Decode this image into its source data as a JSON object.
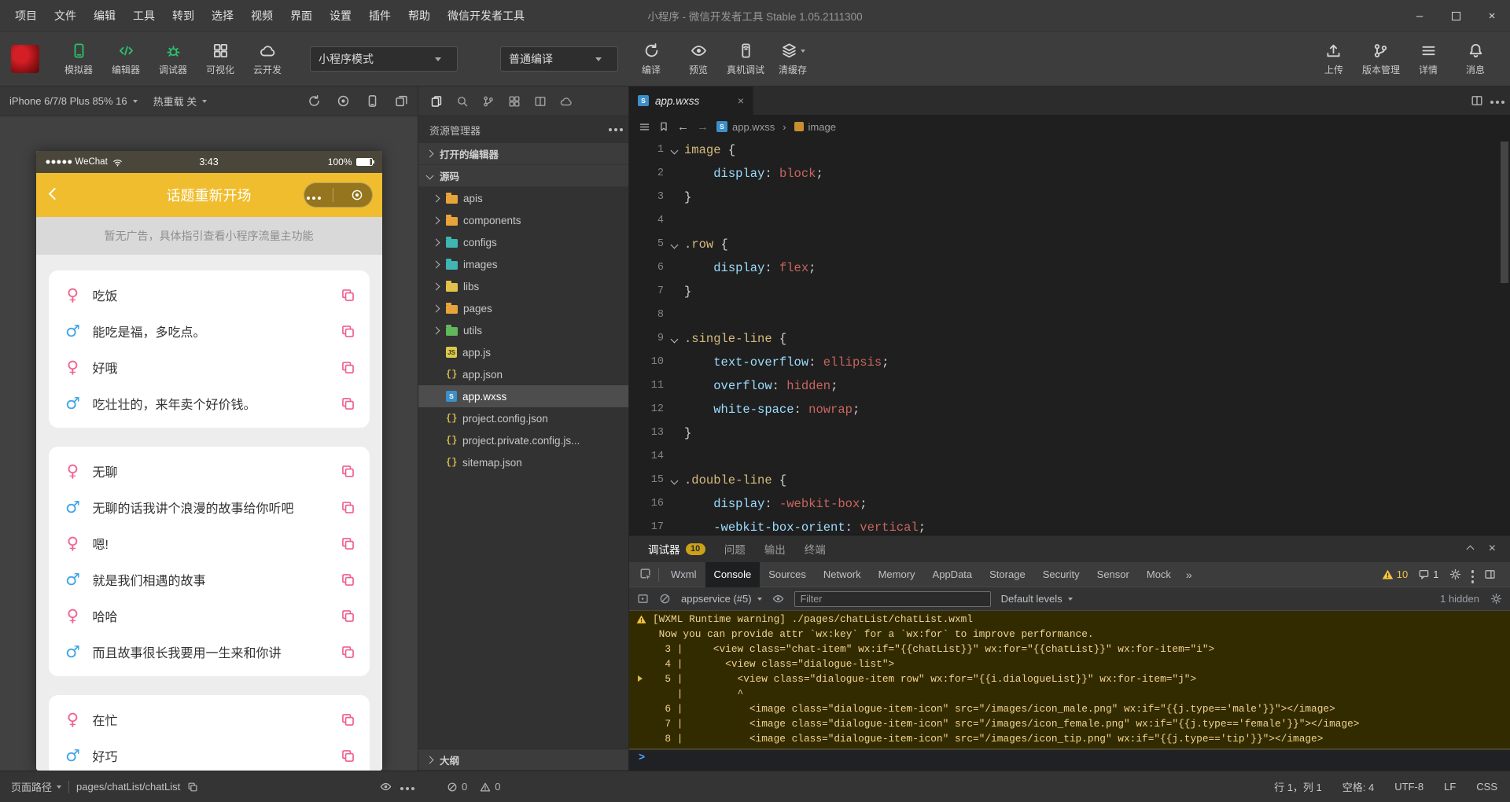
{
  "titlebar": {
    "menus": [
      "项目",
      "文件",
      "编辑",
      "工具",
      "转到",
      "选择",
      "视频",
      "界面",
      "设置",
      "插件",
      "帮助",
      "微信开发者工具"
    ],
    "title": "小程序 - 微信开发者工具 Stable 1.05.2111300"
  },
  "toolbar": {
    "main_tools": [
      {
        "label": "模拟器",
        "icon": "simulator-icon",
        "accent": true
      },
      {
        "label": "编辑器",
        "icon": "editor-icon",
        "accent": true
      },
      {
        "label": "调试器",
        "icon": "debugger-icon",
        "accent": true
      },
      {
        "label": "可视化",
        "icon": "visualizer-icon",
        "accent": false
      },
      {
        "label": "云开发",
        "icon": "cloud-dev-icon",
        "accent": false
      }
    ],
    "mode_select": "小程序模式",
    "compile_select": "普通编译",
    "compile_actions": [
      {
        "label": "编译",
        "icon": "compile-icon"
      },
      {
        "label": "预览",
        "icon": "preview-icon"
      },
      {
        "label": "真机调试",
        "icon": "remote-debug-icon"
      },
      {
        "label": "清缓存",
        "icon": "clear-cache-icon",
        "caret": true
      }
    ],
    "right_tools": [
      {
        "label": "上传",
        "icon": "upload-icon"
      },
      {
        "label": "版本管理",
        "icon": "version-icon"
      },
      {
        "label": "详情",
        "icon": "details-icon"
      },
      {
        "label": "消息",
        "icon": "message-icon"
      }
    ]
  },
  "simulator": {
    "device_label": "iPhone 6/7/8 Plus 85% 16",
    "hot_reload_label": "热重载 关",
    "toolbar_icons": [
      "refresh-icon",
      "record-icon",
      "device-icon",
      "multi-device-icon"
    ],
    "phone": {
      "carrier": "●●●●● WeChat",
      "time": "3:43",
      "battery": "100%",
      "nav_title": "话题重新开场",
      "ad_banner": "暂无广告，具体指引查看小程序流量主功能",
      "chat_cards": [
        {
          "rows": [
            {
              "gender": "female",
              "text": "吃饭"
            },
            {
              "gender": "male",
              "text": "能吃是福，多吃点。"
            },
            {
              "gender": "female",
              "text": "好哦"
            },
            {
              "gender": "male",
              "text": "吃壮壮的，来年卖个好价钱。"
            }
          ]
        },
        {
          "rows": [
            {
              "gender": "female",
              "text": "无聊"
            },
            {
              "gender": "male",
              "text": "无聊的话我讲个浪漫的故事给你听吧"
            },
            {
              "gender": "female",
              "text": "嗯!"
            },
            {
              "gender": "male",
              "text": "就是我们相遇的故事"
            },
            {
              "gender": "female",
              "text": "哈哈"
            },
            {
              "gender": "male",
              "text": "而且故事很长我要用一生来和你讲"
            }
          ]
        },
        {
          "rows": [
            {
              "gender": "female",
              "text": "在忙"
            },
            {
              "gender": "male",
              "text": "好巧"
            }
          ]
        }
      ]
    }
  },
  "explorer": {
    "title": "资源管理器",
    "toolbar_icons": [
      "files-icon",
      "search-icon",
      "branch-icon",
      "grid-icon",
      "split-icon",
      "cloud-icon"
    ],
    "open_editors_label": "打开的编辑器",
    "source_label": "源码",
    "outline_label": "大纲",
    "tree": [
      {
        "name": "apis",
        "kind": "folder",
        "color": "#e7a43b"
      },
      {
        "name": "components",
        "kind": "folder",
        "color": "#e7a43b"
      },
      {
        "name": "configs",
        "kind": "folder",
        "color": "#3fb6b2"
      },
      {
        "name": "images",
        "kind": "folder",
        "color": "#3fb6b2"
      },
      {
        "name": "libs",
        "kind": "folder",
        "color": "#e3c24c"
      },
      {
        "name": "pages",
        "kind": "folder",
        "color": "#e7a43b"
      },
      {
        "name": "utils",
        "kind": "folder",
        "color": "#62b75c"
      },
      {
        "name": "app.js",
        "kind": "js"
      },
      {
        "name": "app.json",
        "kind": "json"
      },
      {
        "name": "app.wxss",
        "kind": "wxss",
        "selected": true
      },
      {
        "name": "project.config.json",
        "kind": "json"
      },
      {
        "name": "project.private.config.js...",
        "kind": "json"
      },
      {
        "name": "sitemap.json",
        "kind": "json"
      }
    ]
  },
  "editor": {
    "tab_name": "app.wxss",
    "breadcrumb": {
      "file": "app.wxss",
      "separator": "›",
      "symbol": "image"
    },
    "code_lines": [
      {
        "n": 1,
        "fold": true,
        "t": [
          [
            "s",
            "image"
          ],
          [
            "d",
            " {"
          ]
        ]
      },
      {
        "n": 2,
        "t": [
          [
            "d",
            "    "
          ],
          [
            "p",
            "display"
          ],
          [
            "d",
            ": "
          ],
          [
            "v",
            "block"
          ],
          [
            "d",
            ";"
          ]
        ]
      },
      {
        "n": 3,
        "t": [
          [
            "d",
            "}"
          ]
        ]
      },
      {
        "n": 4,
        "t": []
      },
      {
        "n": 5,
        "fold": true,
        "t": [
          [
            "s",
            ".row"
          ],
          [
            "d",
            " {"
          ]
        ]
      },
      {
        "n": 6,
        "t": [
          [
            "d",
            "    "
          ],
          [
            "p",
            "display"
          ],
          [
            "d",
            ": "
          ],
          [
            "v",
            "flex"
          ],
          [
            "d",
            ";"
          ]
        ]
      },
      {
        "n": 7,
        "t": [
          [
            "d",
            "}"
          ]
        ]
      },
      {
        "n": 8,
        "t": []
      },
      {
        "n": 9,
        "fold": true,
        "t": [
          [
            "s",
            ".single-line"
          ],
          [
            "d",
            " {"
          ]
        ]
      },
      {
        "n": 10,
        "t": [
          [
            "d",
            "    "
          ],
          [
            "p",
            "text-overflow"
          ],
          [
            "d",
            ": "
          ],
          [
            "v",
            "ellipsis"
          ],
          [
            "d",
            ";"
          ]
        ]
      },
      {
        "n": 11,
        "t": [
          [
            "d",
            "    "
          ],
          [
            "p",
            "overflow"
          ],
          [
            "d",
            ": "
          ],
          [
            "v",
            "hidden"
          ],
          [
            "d",
            ";"
          ]
        ]
      },
      {
        "n": 12,
        "t": [
          [
            "d",
            "    "
          ],
          [
            "p",
            "white-space"
          ],
          [
            "d",
            ": "
          ],
          [
            "v",
            "nowrap"
          ],
          [
            "d",
            ";"
          ]
        ]
      },
      {
        "n": 13,
        "t": [
          [
            "d",
            "}"
          ]
        ]
      },
      {
        "n": 14,
        "t": []
      },
      {
        "n": 15,
        "fold": true,
        "t": [
          [
            "s",
            ".double-line"
          ],
          [
            "d",
            " {"
          ]
        ]
      },
      {
        "n": 16,
        "t": [
          [
            "d",
            "    "
          ],
          [
            "p",
            "display"
          ],
          [
            "d",
            ": "
          ],
          [
            "v",
            "-webkit-box"
          ],
          [
            "d",
            ";"
          ]
        ]
      },
      {
        "n": 17,
        "t": [
          [
            "d",
            "    "
          ],
          [
            "p",
            "-webkit-box-orient"
          ],
          [
            "d",
            ": "
          ],
          [
            "v",
            "vertical"
          ],
          [
            "d",
            ";"
          ]
        ]
      }
    ]
  },
  "debug": {
    "panel_tabs": [
      {
        "label": "调试器",
        "badge": "10",
        "active": true
      },
      {
        "label": "问题"
      },
      {
        "label": "输出"
      },
      {
        "label": "终端"
      }
    ],
    "devtools_tabs": [
      "Wxml",
      "Console",
      "Sources",
      "Network",
      "Memory",
      "AppData",
      "Storage",
      "Security",
      "Sensor",
      "Mock"
    ],
    "active_devtools_tab": "Console",
    "more_tabs_glyph": "»",
    "warn_count": "10",
    "issue_count": "1",
    "console": {
      "context": "appservice (#5)",
      "filter_placeholder": "Filter",
      "levels_label": "Default levels",
      "hidden_label": "1 hidden",
      "warning_lines": [
        {
          "text": "[WXML Runtime warning] ./pages/chatList/chatList.wxml",
          "icon": true
        },
        {
          "text": " Now you can provide attr `wx:key` for a `wx:for` to improve performance."
        },
        {
          "text": "  3 |     <view class=\"chat-item\" wx:if=\"{{chatList}}\" wx:for=\"{{chatList}}\" wx:for-item=\"i\">"
        },
        {
          "text": "  4 |       <view class=\"dialogue-list\">"
        },
        {
          "text": "  5 |         <view class=\"dialogue-item row\" wx:for=\"{{i.dialogueList}}\" wx:for-item=\"j\">",
          "expand": true
        },
        {
          "text": "    |         ^"
        },
        {
          "text": "  6 |           <image class=\"dialogue-item-icon\" src=\"/images/icon_male.png\" wx:if=\"{{j.type=='male'}}\"></image>"
        },
        {
          "text": "  7 |           <image class=\"dialogue-item-icon\" src=\"/images/icon_female.png\" wx:if=\"{{j.type=='female'}}\"></image>"
        },
        {
          "text": "  8 |           <image class=\"dialogue-item-icon\" src=\"/images/icon_tip.png\" wx:if=\"{{j.type=='tip'}}\"></image>"
        }
      ],
      "prompt": ">"
    }
  },
  "statusbar": {
    "page_path_label": "页面路径",
    "page_path": "pages/chatList/chatList",
    "error_count": "0",
    "warning_count": "0",
    "cursor": "行 1，列 1",
    "spaces": "空格: 4",
    "encoding": "UTF-8",
    "eol": "LF",
    "language": "CSS"
  },
  "colors": {
    "accent_green": "#2bc06c",
    "nav_yellow": "#f0bd2f",
    "female_pink": "#f0628e",
    "male_blue": "#3da4e8",
    "copy_pink": "#ee5f8d",
    "warning_yellow": "#f5c542"
  }
}
